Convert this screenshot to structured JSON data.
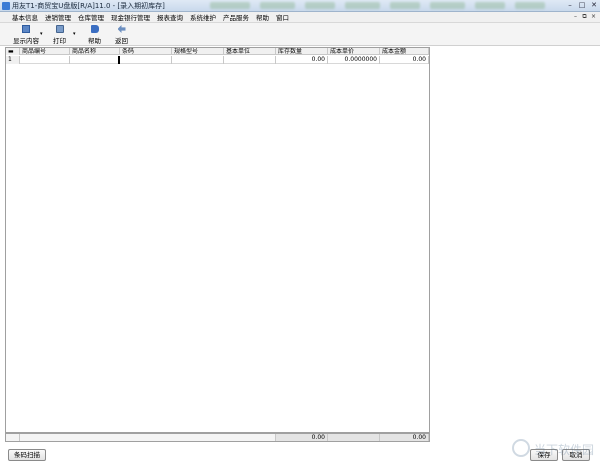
{
  "window": {
    "title": "用友T1-商贸宝U盘版[R/A]11.0 - [录入期初库存]",
    "controls": {
      "minimize": "–",
      "maximize": "□",
      "close": "✕"
    }
  },
  "menubar": {
    "items": [
      "基本信息",
      "进销管理",
      "仓库管理",
      "现金银行管理",
      "报表查询",
      "系统维护",
      "产品服务",
      "帮助",
      "窗口"
    ],
    "right_controls": {
      "minimize": "–",
      "restore": "⧉",
      "close": "×"
    }
  },
  "toolbar": {
    "buttons": [
      {
        "label": "显示内容",
        "icon": "display-icon"
      },
      {
        "label": "打印",
        "icon": "print-icon"
      },
      {
        "label": "帮助",
        "icon": "help-icon"
      },
      {
        "label": "返回",
        "icon": "back-icon"
      }
    ],
    "dropdown_glyph": "▾"
  },
  "grid": {
    "columns": [
      "商品编号",
      "商品名称",
      "条码",
      "规格型号",
      "基本单位",
      "库存数量",
      "成本单价",
      "成本金额"
    ],
    "rows": [
      {
        "row_no": "1",
        "qty": "0.00",
        "unit_cost": "0.0000000",
        "amount": "0.00"
      }
    ],
    "footer": {
      "qty_total": "0.00",
      "amount_total": "0.00"
    }
  },
  "buttons": {
    "barcode_scan": "条码扫描",
    "save": "保存",
    "cancel": "取消"
  },
  "colors": {
    "title_bar": "#c9d9ec",
    "menu_bg": "#f0f0f0",
    "grid_border": "#a0a0a0"
  }
}
